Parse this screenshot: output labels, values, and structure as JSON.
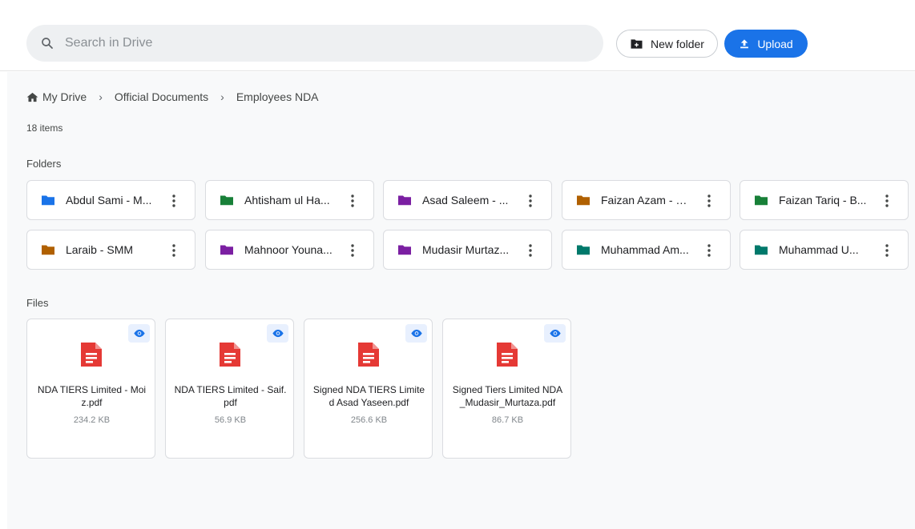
{
  "search": {
    "placeholder": "Search in Drive"
  },
  "toolbar": {
    "new_folder_label": "New folder",
    "upload_label": "Upload"
  },
  "breadcrumb": [
    "My Drive",
    "Official Documents",
    "Employees NDA"
  ],
  "item_count": "18 items",
  "sections": {
    "folders": "Folders",
    "files": "Files"
  },
  "folders": [
    {
      "name": "Abdul Sami - M...",
      "color": "#1a73e8"
    },
    {
      "name": "Ahtisham ul Ha...",
      "color": "#188038"
    },
    {
      "name": "Asad Saleem - ...",
      "color": "#7b1fa2"
    },
    {
      "name": "Faizan Azam - SE",
      "color": "#b06000"
    },
    {
      "name": "Faizan Tariq - B...",
      "color": "#188038"
    },
    {
      "name": "Laraib - SMM",
      "color": "#b06000"
    },
    {
      "name": "Mahnoor Youna...",
      "color": "#7b1fa2"
    },
    {
      "name": "Mudasir Murtaz...",
      "color": "#7b1fa2"
    },
    {
      "name": "Muhammad Am...",
      "color": "#00796b"
    },
    {
      "name": "Muhammad U...",
      "color": "#00796b"
    }
  ],
  "files": [
    {
      "name": "NDA TIERS Limited - Moiz.pdf",
      "size": "234.2 KB"
    },
    {
      "name": "NDA TIERS Limited - Saif.pdf",
      "size": "56.9 KB"
    },
    {
      "name": "Signed NDA TIERS Limited Asad Yaseen.pdf",
      "size": "256.6 KB"
    },
    {
      "name": "Signed Tiers Limited NDA_Mudasir_Murtaza.pdf",
      "size": "86.7 KB"
    }
  ],
  "colors": {
    "accent": "#1a73e8",
    "pdf": "#e53935"
  }
}
